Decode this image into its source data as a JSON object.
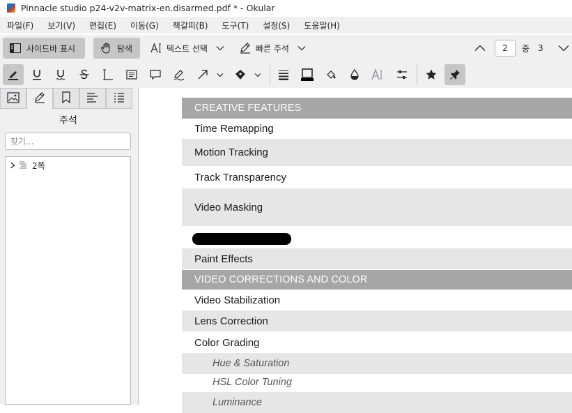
{
  "window": {
    "title": "Pinnacle studio p24-v2v-matrix-en.disarmed.pdf * - Okular"
  },
  "menubar": {
    "items": [
      "파일(F)",
      "보기(V)",
      "편집(E)",
      "이동(G)",
      "책갈피(B)",
      "도구(T)",
      "설정(S)",
      "도움말(H)"
    ]
  },
  "toolbar": {
    "sidebar_toggle": "사이드바 표시",
    "browse": "탐색",
    "text_select": "텍스트 선택",
    "quick_annotations": "빠른 주석",
    "page_current": "2",
    "page_of": "중",
    "page_total": "3"
  },
  "sidebar": {
    "title": "주석",
    "search_placeholder": "찾기...",
    "tree_item": "2쪽"
  },
  "document": {
    "rows": [
      {
        "text": "CREATIVE FEATURES",
        "style": "hdr"
      },
      {
        "text": "Time Remapping",
        "style": "white"
      },
      {
        "text": "Motion Tracking",
        "style": "alt"
      },
      {
        "text": "Track Transparency",
        "style": "white"
      },
      {
        "text": "Video Masking",
        "style": "alt"
      },
      {
        "text": "",
        "style": "white"
      },
      {
        "text": "Paint Effects",
        "style": "alt"
      },
      {
        "text": "VIDEO CORRECTIONS AND COLOR",
        "style": "hdr"
      },
      {
        "text": "Video Stabilization",
        "style": "white"
      },
      {
        "text": "Lens Correction",
        "style": "alt"
      },
      {
        "text": "Color Grading",
        "style": "white"
      },
      {
        "text": "Hue & Saturation",
        "style": "alt"
      },
      {
        "text": "HSL Color Tuning",
        "style": "white"
      },
      {
        "text": "Luminance",
        "style": "alt"
      }
    ]
  },
  "colors": {
    "toolbar_bg": "#eff0f1",
    "pressed_bg": "#c4c6c8",
    "section_header": "#a5a6a8",
    "row_alt": "#e6e6e6"
  }
}
